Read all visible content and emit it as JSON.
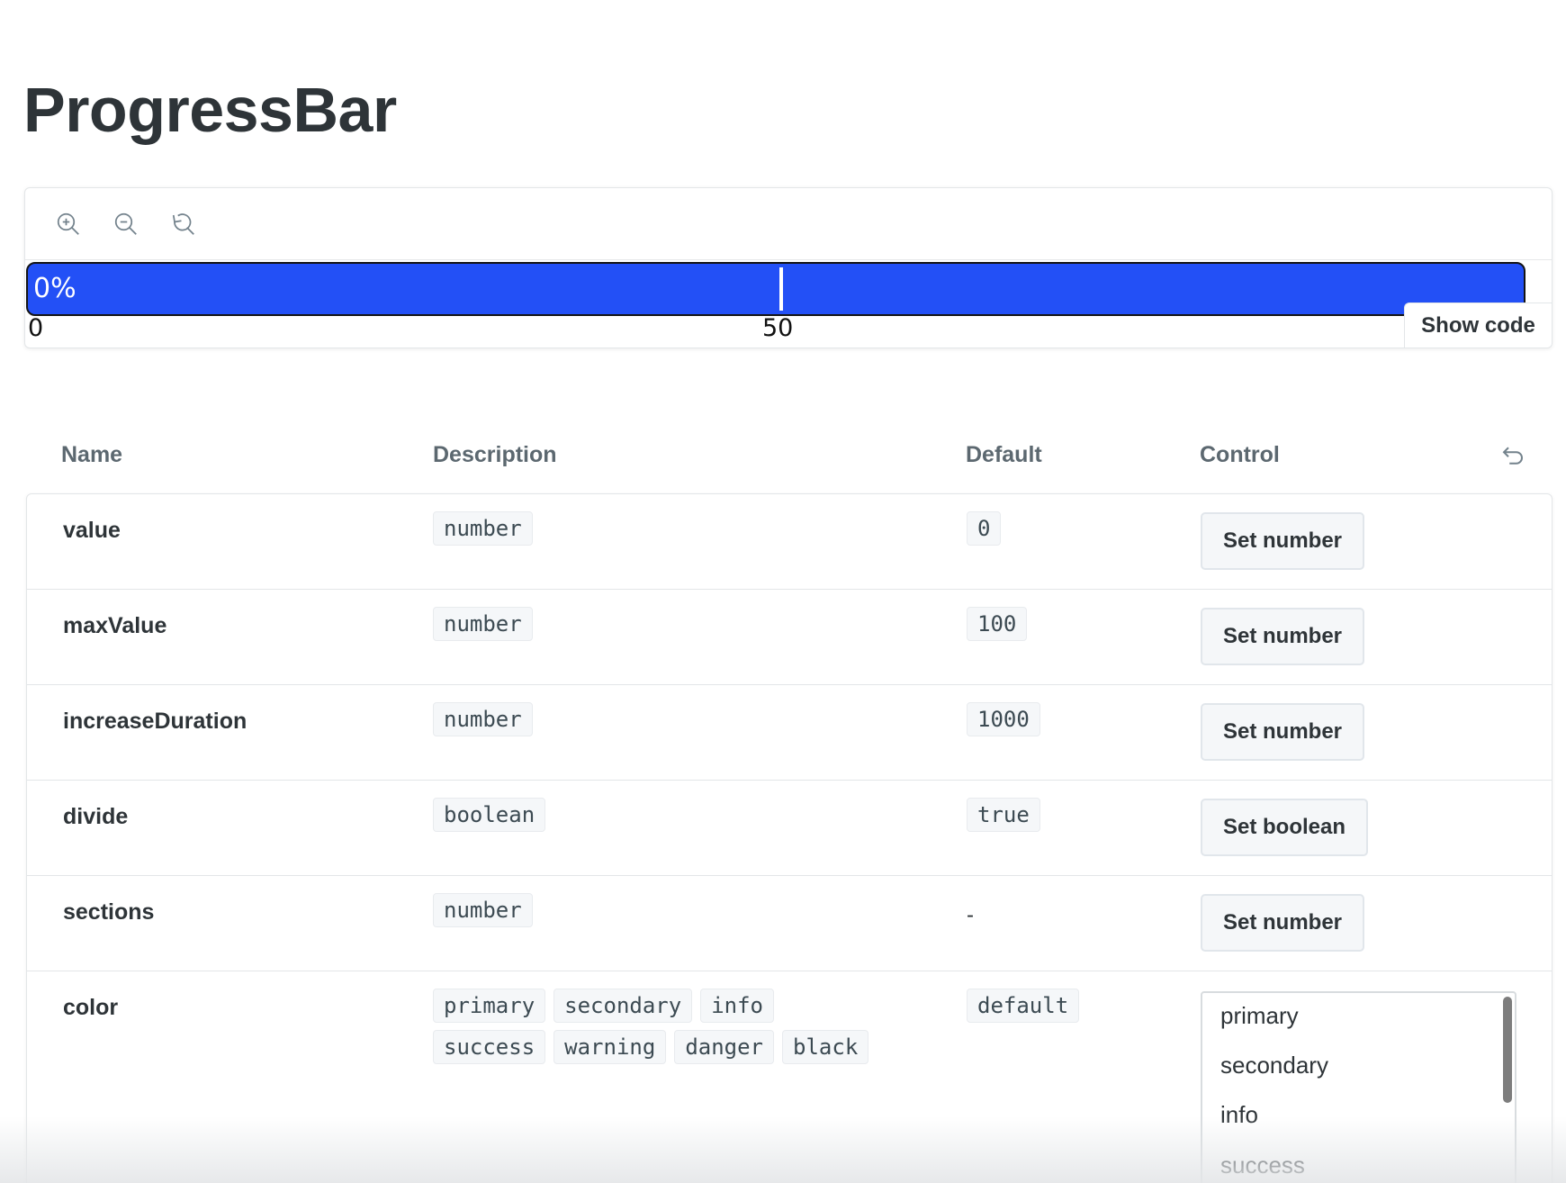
{
  "page": {
    "title": "ProgressBar"
  },
  "preview": {
    "toolbar": [
      {
        "name": "zoom-in",
        "icon": "zoom-in-icon"
      },
      {
        "name": "zoom-out",
        "icon": "zoom-out-icon"
      },
      {
        "name": "reset-zoom",
        "icon": "reset-zoom-icon"
      }
    ],
    "progress": {
      "label": "0%",
      "value": 0,
      "scale_start": "0",
      "scale_mid": "50",
      "bar_color": "#2350f6",
      "border_color": "#141414"
    },
    "show_code_label": "Show code"
  },
  "args_table": {
    "headers": {
      "name": "Name",
      "description": "Description",
      "default": "Default",
      "control": "Control"
    },
    "reset_icon": "undo-icon",
    "rows": [
      {
        "name": "value",
        "types": [
          "number"
        ],
        "default": "0",
        "control": "Set number"
      },
      {
        "name": "maxValue",
        "types": [
          "number"
        ],
        "default": "100",
        "control": "Set number"
      },
      {
        "name": "increaseDuration",
        "types": [
          "number"
        ],
        "default": "1000",
        "control": "Set number"
      },
      {
        "name": "divide",
        "types": [
          "boolean"
        ],
        "default": "true",
        "control": "Set boolean"
      },
      {
        "name": "sections",
        "types": [
          "number"
        ],
        "default": "-",
        "control": "Set number"
      },
      {
        "name": "color",
        "types": [
          "primary",
          "secondary",
          "info",
          "success",
          "warning",
          "danger",
          "black"
        ],
        "default": "default",
        "control_options": [
          "primary",
          "secondary",
          "info",
          "success"
        ]
      }
    ]
  }
}
